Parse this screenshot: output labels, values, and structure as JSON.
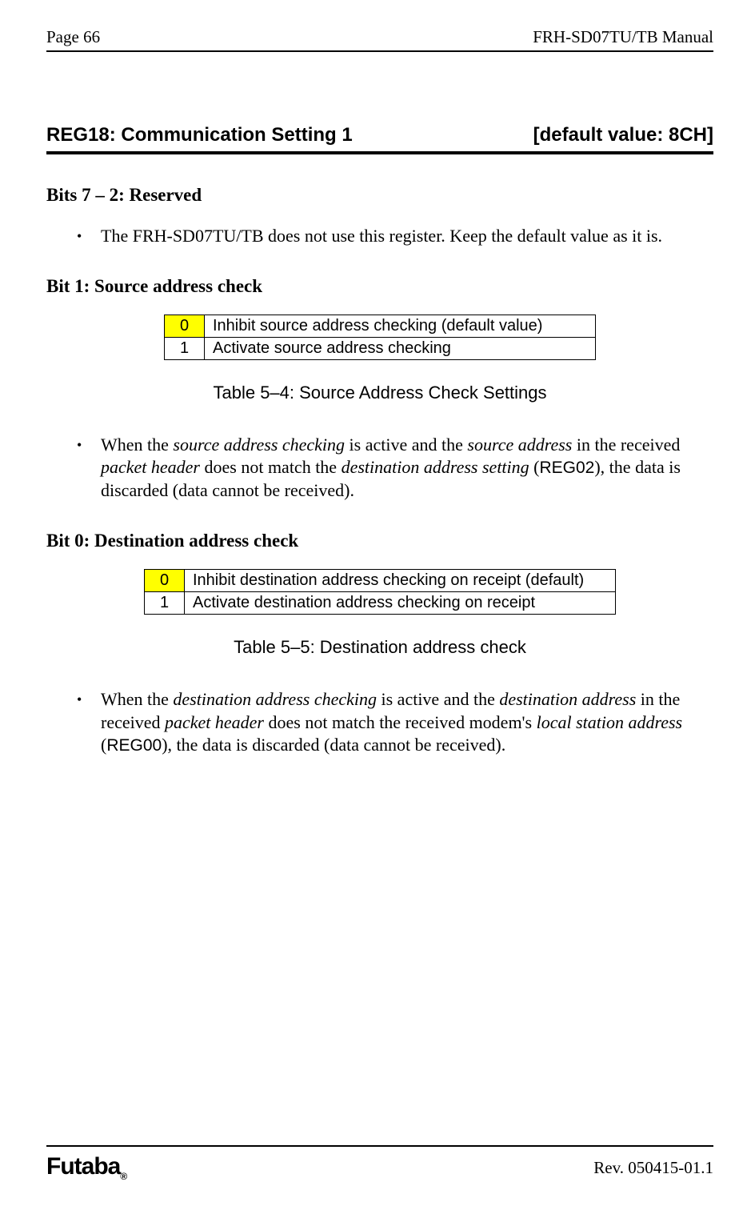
{
  "header": {
    "left": "Page  66",
    "right": "FRH-SD07TU/TB Manual"
  },
  "section": {
    "title": "REG18:  Communication Setting 1",
    "default": "[default value: 8CH]"
  },
  "bits72": {
    "label": "Bits 7 – 2:  Reserved",
    "bullet": "The FRH-SD07TU/TB does not use this register. Keep the default value as it is."
  },
  "bit1": {
    "label": "Bit 1:  Source address check",
    "rows": [
      {
        "code": "0",
        "desc": "Inhibit source address checking  (default value)",
        "hl": true
      },
      {
        "code": "1",
        "desc": "Activate source address checking",
        "hl": false
      }
    ],
    "caption": "Table 5–4:  Source Address Check Settings",
    "bullet_parts": {
      "p1": "When the ",
      "i1": "source address checking",
      "p2": " is active and the ",
      "i2": "source address",
      "p3": " in the received ",
      "i3": "packet header",
      "p4": " does not match the ",
      "i4": "destination address setting",
      "p5": " (",
      "s1": "REG02",
      "p6": "), the data is discarded (data cannot be received)."
    }
  },
  "bit0": {
    "label": "Bit 0:  Destination address check",
    "rows": [
      {
        "code": "0",
        "desc": "Inhibit destination  address checking on receipt (default)",
        "hl": true
      },
      {
        "code": "1",
        "desc": "Activate destination address checking on receipt",
        "hl": false
      }
    ],
    "caption": "Table 5–5:  Destination address check",
    "bullet_parts": {
      "p1": "When the ",
      "i1": "destination address checking",
      "p2": " is active and the ",
      "i2": "destination address",
      "p3": " in the received ",
      "i3": "packet header",
      "p4": " does not match the received modem's ",
      "i4": "local station address",
      "p5": " (",
      "s1": "REG00",
      "p6": "), the data is discarded (data cannot be received)."
    }
  },
  "footer": {
    "brand": "Futaba",
    "reg": "®",
    "rev": "Rev. 050415-01.1"
  }
}
